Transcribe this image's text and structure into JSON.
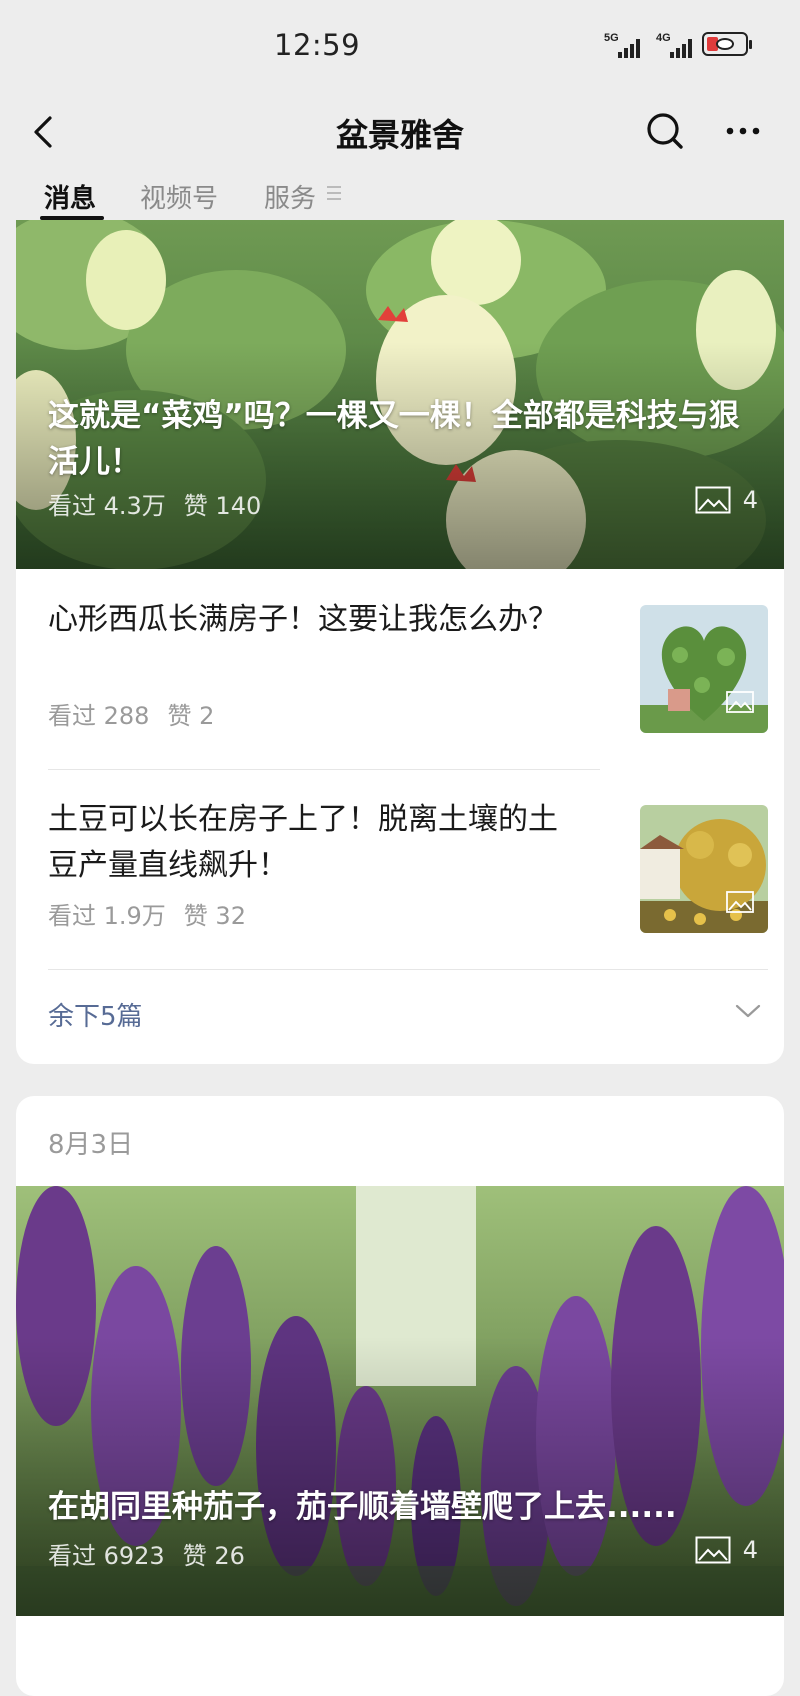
{
  "status_bar": {
    "time": "12:59",
    "signal_1": "5G",
    "signal_2": "4G",
    "battery_icon": "battery-saver-icon"
  },
  "nav": {
    "title": "盆景雅舍",
    "back_icon": "back-arrow-icon",
    "search_icon": "search-icon",
    "more_icon": "more-dots-icon"
  },
  "tabs": [
    {
      "label": "消息",
      "active": true
    },
    {
      "label": "视频号",
      "active": false
    },
    {
      "label": "服务",
      "active": false
    }
  ],
  "group1": {
    "hero": {
      "title": "这就是“菜鸡”吗？一棵又一棵！全部都是科技与狠活儿！",
      "views": "看过 4.3万",
      "likes": "赞 140",
      "image_count": "4"
    },
    "articles": [
      {
        "title": "心形西瓜长满房子！这要让我怎么办？",
        "views": "看过 288",
        "likes": "赞 2"
      },
      {
        "title": "土豆可以长在房子上了！脱离土壤的土豆产量直线飙升！",
        "views": "看过 1.9万",
        "likes": "赞 32"
      }
    ],
    "remaining": "余下5篇"
  },
  "group2": {
    "date": "8月3日",
    "hero": {
      "title": "在胡同里种茄子，茄子顺着墙壁爬了上去......",
      "views": "看过 6923",
      "likes": "赞 26",
      "image_count": "4"
    }
  },
  "colors": {
    "background": "#ededed",
    "card": "#ffffff",
    "link": "#576b95",
    "meta": "#9a9a9a"
  }
}
